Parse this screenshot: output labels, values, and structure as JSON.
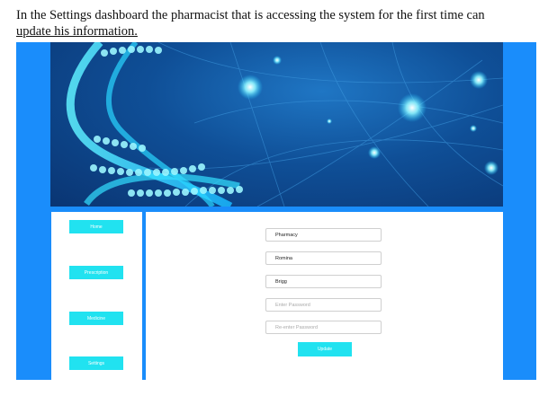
{
  "caption": {
    "line1": "In the Settings dashboard the pharmacist that is accessing the system for the first time can",
    "line2": "update his information."
  },
  "sidebar": {
    "items": [
      {
        "label": "Home"
      },
      {
        "label": "Prescription"
      },
      {
        "label": "Medicine"
      },
      {
        "label": "Settings"
      }
    ]
  },
  "form": {
    "pharmacy_value": "Pharmacy",
    "first_name_value": "Romina",
    "last_name_value": "Brigg",
    "password_placeholder": "Enter Password",
    "reenter_password_placeholder": "Re-enter Password",
    "update_label": "Update"
  },
  "colors": {
    "frame": "#1a8dfb",
    "button": "#21e2f0",
    "banner_dark": "#0a3573"
  }
}
